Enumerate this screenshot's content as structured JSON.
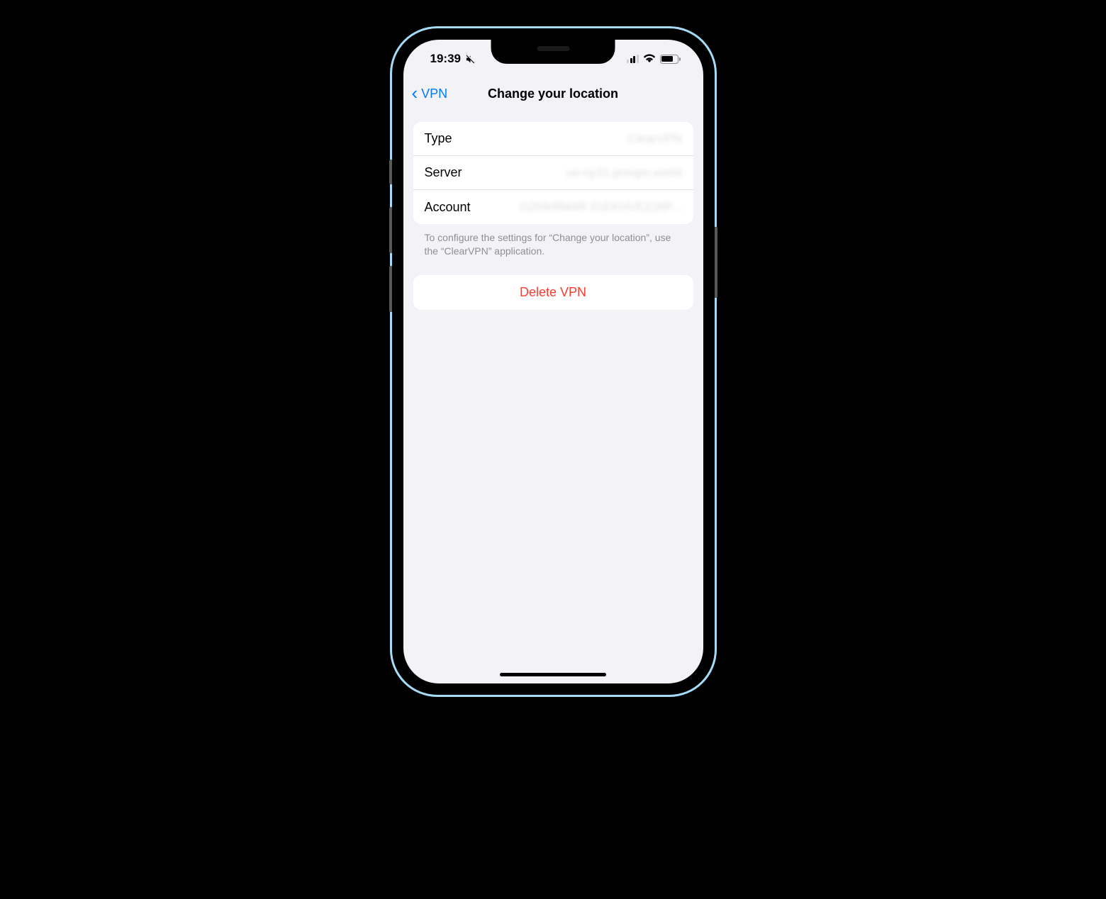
{
  "statusBar": {
    "time": "19:39"
  },
  "nav": {
    "backLabel": "VPN",
    "title": "Change your location"
  },
  "details": {
    "rows": [
      {
        "label": "Type",
        "value": "ClearVPN"
      },
      {
        "label": "Server",
        "value": "us-ny31.provpn.world"
      },
      {
        "label": "Account",
        "value": "G2h9rBM4R 01EKHVEZ26P..."
      }
    ],
    "footer": "To configure the settings for “Change your location”, use the “ClearVPN” application."
  },
  "actions": {
    "deleteLabel": "Delete VPN"
  }
}
